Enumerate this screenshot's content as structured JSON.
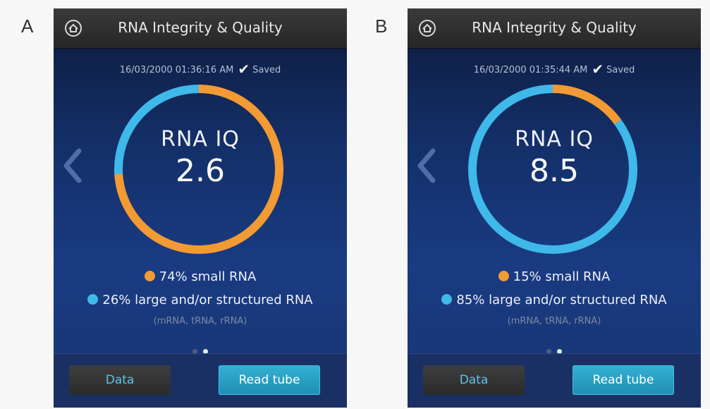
{
  "colors": {
    "small_rna": "#f29a33",
    "large_rna": "#3fb8ea"
  },
  "panels": [
    {
      "letter": "A",
      "title": "RNA Integrity & Quality",
      "timestamp": "16/03/2000 01:36:16 AM",
      "saved_label": "Saved",
      "iq_label": "RNA IQ",
      "iq_value": "2.6",
      "small_rna_fraction": 0.74,
      "small_rna_text": "74% small RNA",
      "large_rna_text": "26% large and/or structured RNA",
      "sub_text": "(mRNA, tRNA, rRNA)",
      "data_button": "Data",
      "read_button": "Read tube",
      "icons": {
        "home": "home-icon",
        "back": "chevron-left-icon",
        "saved": "checkmark-icon"
      }
    },
    {
      "letter": "B",
      "title": "RNA Integrity & Quality",
      "timestamp": "16/03/2000 01:35:44 AM",
      "saved_label": "Saved",
      "iq_label": "RNA IQ",
      "iq_value": "8.5",
      "small_rna_fraction": 0.15,
      "small_rna_text": "15% small RNA",
      "large_rna_text": "85% large and/or structured RNA",
      "sub_text": "(mRNA, tRNA, rRNA)",
      "data_button": "Data",
      "read_button": "Read tube",
      "icons": {
        "home": "home-icon",
        "back": "chevron-left-icon",
        "saved": "checkmark-icon"
      }
    }
  ]
}
